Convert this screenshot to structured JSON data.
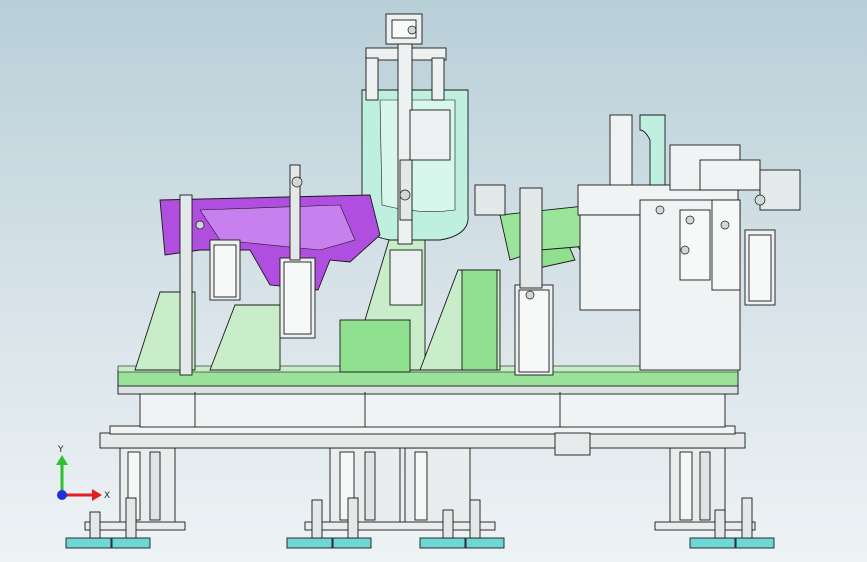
{
  "viewport": {
    "background_top": "#b8cfd8",
    "background_bottom": "#eef3f5"
  },
  "model": {
    "description_colors": {
      "steel": "#e8ecec",
      "outline": "#1a1a1a",
      "green": "#8de08d",
      "light_green": "#c8ecc8",
      "mint": "#bff0e0",
      "purple": "#b04ee0",
      "feet": "#6fd6d6"
    }
  },
  "triad": {
    "y_label": "Y",
    "x_label": "X",
    "y_color": "#2fbf2f",
    "x_color": "#e02020",
    "z_color": "#2030e0"
  }
}
